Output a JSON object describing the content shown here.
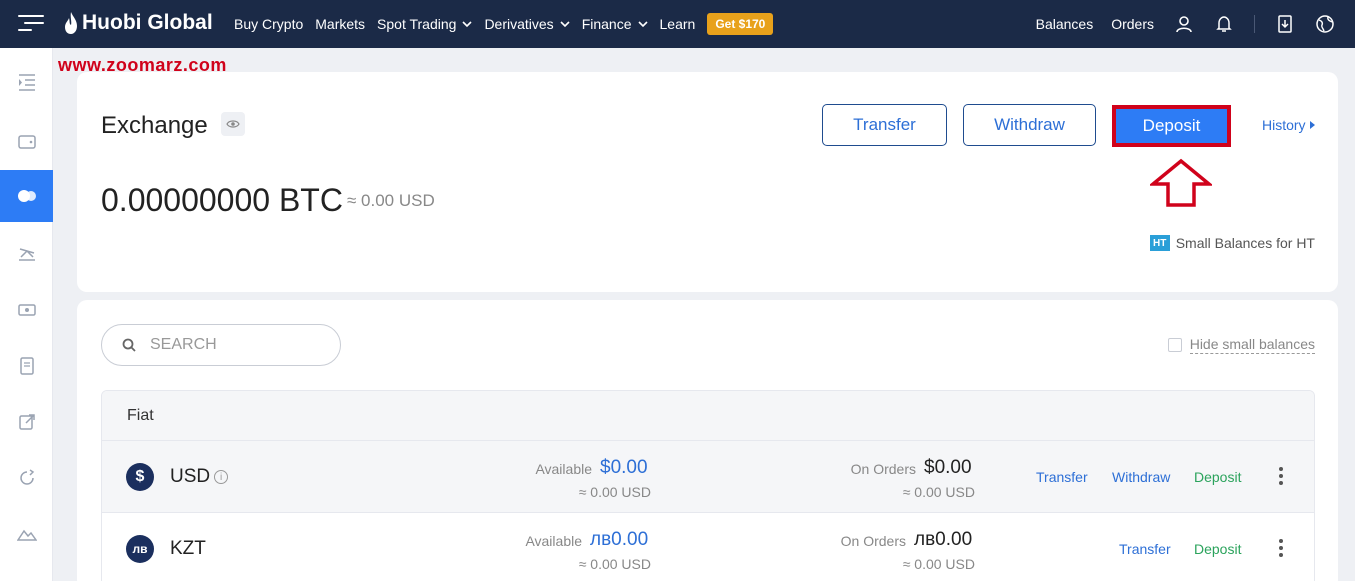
{
  "nav": {
    "logo_text": "Huobi Global",
    "items": [
      {
        "label": "Buy Crypto",
        "dropdown": false
      },
      {
        "label": "Markets",
        "dropdown": false
      },
      {
        "label": "Spot Trading",
        "dropdown": true
      },
      {
        "label": "Derivatives",
        "dropdown": true
      },
      {
        "label": "Finance",
        "dropdown": true
      },
      {
        "label": "Learn",
        "dropdown": false
      }
    ],
    "promo": "Get $170",
    "right": {
      "balances": "Balances",
      "orders": "Orders"
    }
  },
  "watermark": "www.zoomarz.com",
  "exchange": {
    "title": "Exchange",
    "balance": "0.00000000 BTC",
    "approx": "≈ 0.00 USD",
    "buttons": {
      "transfer": "Transfer",
      "withdraw": "Withdraw",
      "deposit": "Deposit"
    },
    "history": "History",
    "small_balances": "Small Balances for HT",
    "ht_badge": "HT"
  },
  "assets": {
    "search_placeholder": "SEARCH",
    "hide_small": "Hide small balances",
    "section": "Fiat",
    "available_label": "Available",
    "on_orders_label": "On Orders",
    "rows": [
      {
        "symbol": "USD",
        "icon_glyph": "$",
        "available": "$0.00",
        "available_usd": "≈ 0.00 USD",
        "on_orders": "$0.00",
        "on_orders_usd": "≈ 0.00 USD",
        "actions": [
          "Transfer",
          "Withdraw",
          "Deposit"
        ]
      },
      {
        "symbol": "KZT",
        "icon_glyph": "лв",
        "available": "лв0.00",
        "available_usd": "≈ 0.00 USD",
        "on_orders": "лв0.00",
        "on_orders_usd": "≈ 0.00 USD",
        "actions": [
          "Transfer",
          "Deposit"
        ]
      }
    ]
  },
  "colors": {
    "nav_bg": "#1b2a47",
    "accent": "#2d7cf5",
    "highlight": "#d0021b",
    "promo": "#e8a11b",
    "green": "#2ba35c"
  }
}
